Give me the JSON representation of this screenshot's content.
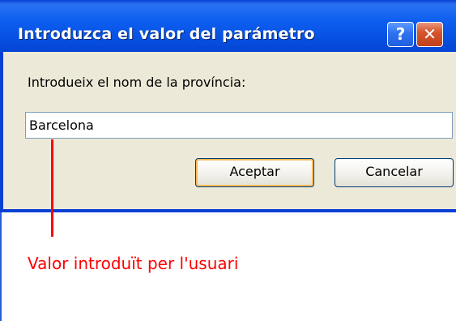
{
  "dialog": {
    "title": "Introduzca el valor del parámetro",
    "help_label": "?",
    "close_label": "✕",
    "prompt": "Introdueix el nom de la província:",
    "input_value": "Barcelona",
    "ok_label": "Aceptar",
    "cancel_label": "Cancelar"
  },
  "annotation": {
    "text": "Valor introduït per l'usuari",
    "color": "#ff0000"
  },
  "colors": {
    "titlebar": "#0d5ef0",
    "dialog_body": "#ece9d8",
    "close_button": "#d6552d"
  }
}
